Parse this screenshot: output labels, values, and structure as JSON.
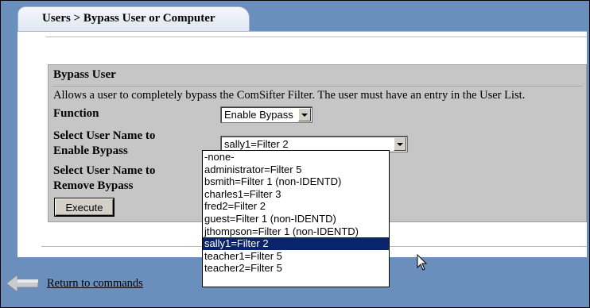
{
  "tab": {
    "label": "Users > Bypass User or Computer"
  },
  "form": {
    "header": "Bypass User",
    "description": "Allows a user to completely bypass the ComSifter Filter. The user must have an entry in the User List.",
    "function_label": "Function",
    "function_value": "Enable Bypass",
    "enable_label_line1": "Select User Name to",
    "enable_label_line2": "Enable Bypass",
    "enable_value": "sally1=Filter 2",
    "remove_label_line1": "Select User Name to",
    "remove_label_line2": "Remove Bypass",
    "execute_label": "Execute"
  },
  "dropdown_options": [
    "-none-",
    "administrator=Filter 5",
    "bsmith=Filter 1 (non-IDENTD)",
    "charles1=Filter 3",
    "fred2=Filter 2",
    "guest=Filter 1 (non-IDENTD)",
    "jthompson=Filter 1 (non-IDENTD)",
    "sally1=Filter 2",
    "teacher1=Filter 5",
    "teacher2=Filter 5"
  ],
  "selected_option": "sally1=Filter 2",
  "footer": {
    "return_link": "Return to commands"
  }
}
